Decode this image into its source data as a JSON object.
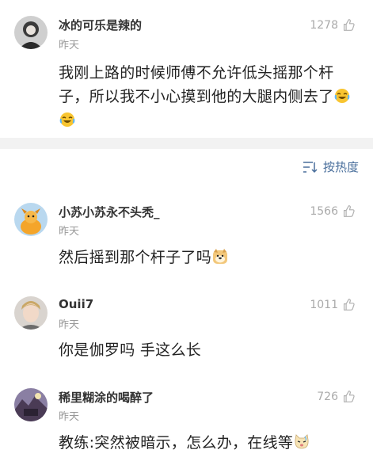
{
  "comments": [
    {
      "author": "冰的可乐是辣的",
      "time": "昨天",
      "likes": "1278",
      "text": "我刚上路的时候师傅不允许低头摇那个杆子，所以我不小心摸到他的大腿内侧去了",
      "emojis": [
        "laugh-cry-emoji",
        "laugh-cry-emoji"
      ]
    },
    {
      "author": "小苏小苏永不头秃_",
      "time": "昨天",
      "likes": "1566",
      "text": "然后摇到那个杆子了吗",
      "emojis": [
        "doge-emoji"
      ]
    },
    {
      "author": "Ouii7",
      "time": "昨天",
      "likes": "1011",
      "text": "你是伽罗吗 手这么长",
      "emojis": []
    },
    {
      "author": "稀里糊涂的喝醉了",
      "time": "昨天",
      "likes": "726",
      "text": "教练:突然被暗示，怎么办，在线等",
      "emojis": [
        "cat-emoji"
      ]
    }
  ],
  "sort": {
    "label": "按热度",
    "icon": "sort-icon"
  },
  "colors": {
    "link": "#4a6f9c",
    "divider": "#f2f2f2",
    "meta": "#999999"
  }
}
